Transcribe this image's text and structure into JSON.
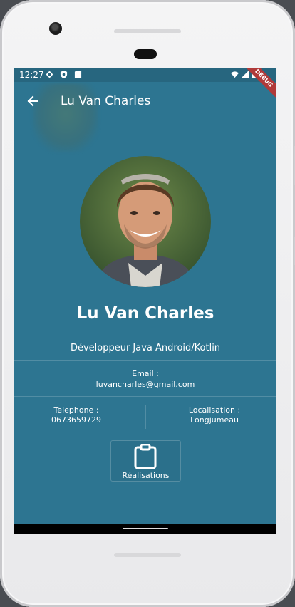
{
  "status": {
    "time": "12:27",
    "debug_label": "DEBUG"
  },
  "appbar": {
    "title": "Lu Van Charles"
  },
  "profile": {
    "name": "Lu Van Charles",
    "job": "Développeur Java Android/Kotlin",
    "email_label": "Email :",
    "email_value": "luvancharles@gmail.com",
    "phone_label": "Telephone :",
    "phone_value": "0673659729",
    "location_label": "Localisation :",
    "location_value": "Longjumeau"
  },
  "actions": {
    "realisations_label": "Réalisations"
  },
  "colors": {
    "background": "#2d7591",
    "status_bar": "#27667f",
    "text": "#ffffff"
  }
}
